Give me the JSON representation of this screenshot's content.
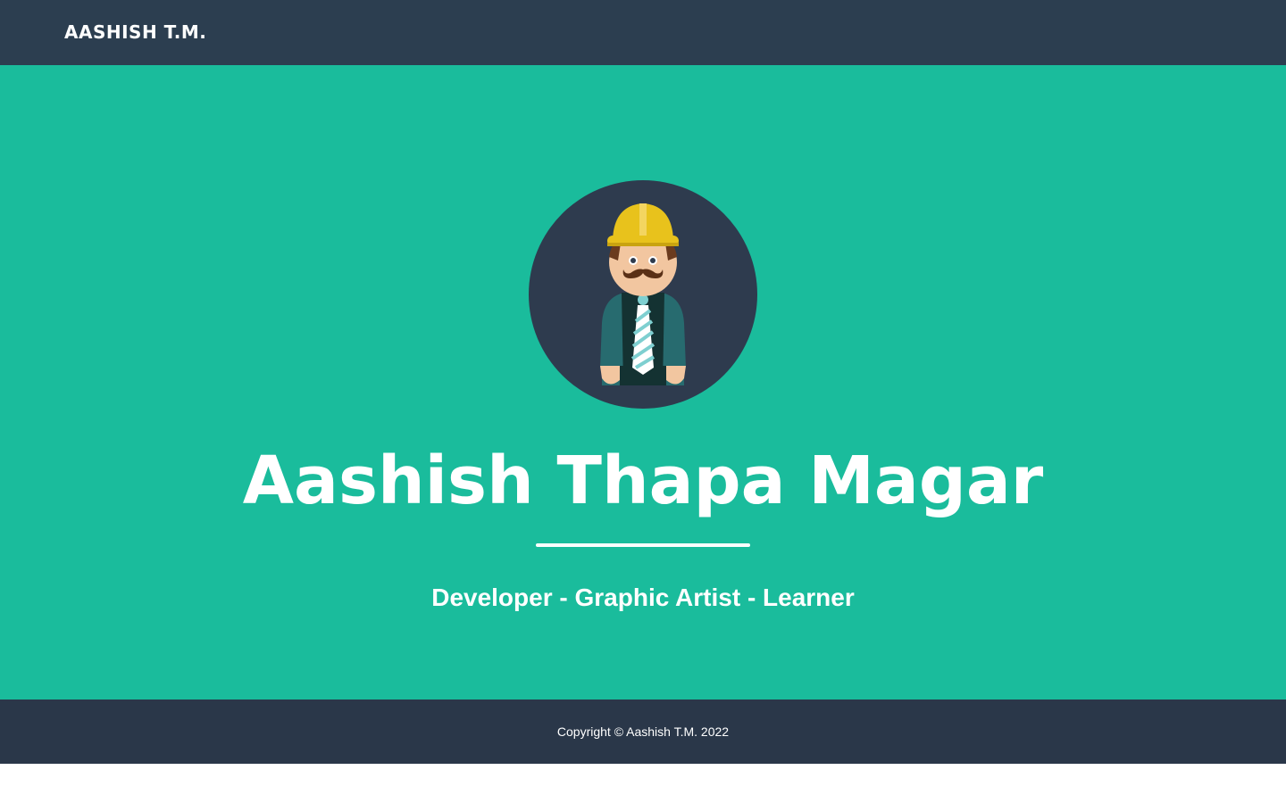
{
  "navbar": {
    "brand": "AASHISH T.M."
  },
  "masthead": {
    "avatar_icon": "engineer-avatar-icon",
    "title": "Aashish Thapa Magar",
    "subtitle": "Developer - Graphic Artist - Learner"
  },
  "footer": {
    "copyright": "Copyright © Aashish T.M. 2022"
  },
  "colors": {
    "navbar_bg": "#2c3e50",
    "masthead_bg": "#1abc9c",
    "footer_bg": "#2a3749",
    "text": "#ffffff"
  }
}
